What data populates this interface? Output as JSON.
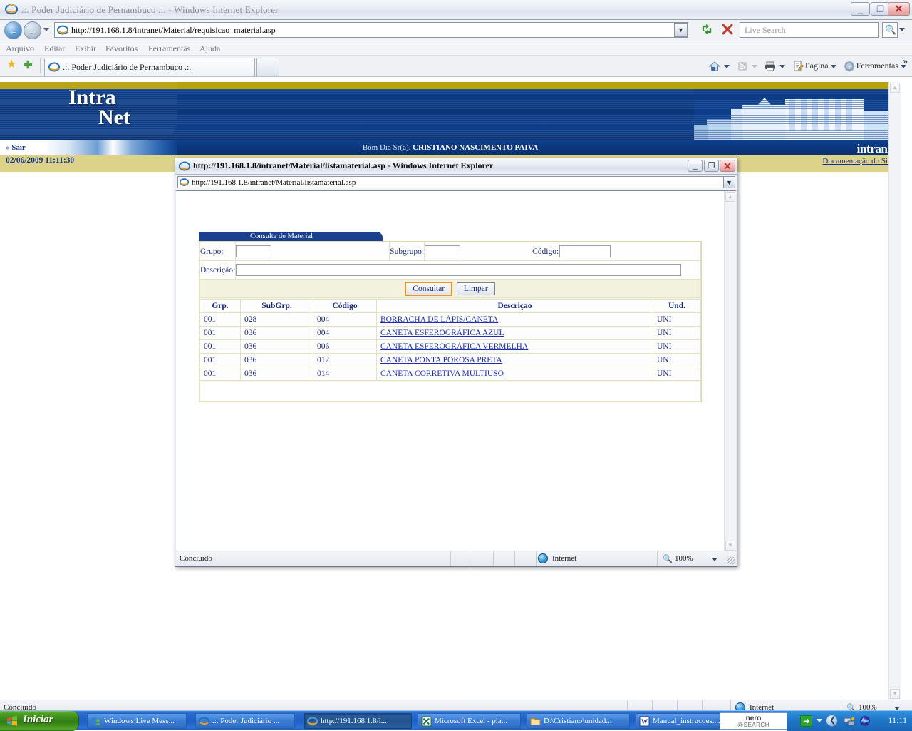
{
  "main_window": {
    "title": ".:. Poder Judiciário de Pernambuco .:. - Windows Internet Explorer",
    "address": "http://191.168.1.8/intranet/Material/requisicao_material.asp",
    "search_placeholder": "Live Search",
    "menu": [
      "Arquivo",
      "Editar",
      "Exibir",
      "Favoritos",
      "Ferramentas",
      "Ajuda"
    ],
    "tab_label": ".:. Poder Judiciário de Pernambuco .:.",
    "command_bar": [
      {
        "label": "",
        "icon": "home-icon"
      },
      {
        "label": "",
        "icon": "rss-icon"
      },
      {
        "label": "",
        "icon": "print-icon"
      },
      {
        "label": "Página",
        "icon": "page-icon"
      },
      {
        "label": "Ferramentas",
        "icon": "gear-icon"
      }
    ],
    "status_text": "Concluído",
    "zone": "Internet",
    "zoom": "100%"
  },
  "intranet": {
    "logo_line1": "Intra",
    "logo_line2": "Net",
    "logout_label": "« Sair",
    "greeting_prefix": "Bom Dia Sr(a).",
    "user_name": "CRISTIANO NASCIMENTO PAIVA",
    "brand_tag": "intranet",
    "datetime": "02/06/2009 11:11:30",
    "doc_link": "Documentação do Site",
    "colors": {
      "banner_blue": "#0b3f8f",
      "gold": "#b8a10c",
      "gold_bar": "#ddd28a",
      "link_blue": "#10348c"
    }
  },
  "popup": {
    "title": "http://191.168.1.8/intranet/Material/listamaterial.asp - Windows Internet Explorer",
    "address": "http://191.168.1.8/intranet/Material/listamaterial.asp",
    "status_text": "Concluído",
    "zone": "Internet",
    "zoom": "100%",
    "form": {
      "card_title": "Consulta de Material",
      "fields": [
        {
          "label": "Grupo:",
          "value": ""
        },
        {
          "label": "Subgrupo:",
          "value": ""
        },
        {
          "label": "Código:",
          "value": ""
        },
        {
          "label": "Descrição:",
          "value": ""
        }
      ],
      "submit_label": "Consultar",
      "clear_label": "Limpar"
    },
    "results": {
      "headers": [
        "Grp.",
        "SubGrp.",
        "Código",
        "Descriçao",
        "Und."
      ],
      "rows": [
        {
          "grp": "001",
          "subgrp": "028",
          "codigo": "004",
          "descricao": "BORRACHA DE LÁPIS/CANETA",
          "und": "UNI"
        },
        {
          "grp": "001",
          "subgrp": "036",
          "codigo": "004",
          "descricao": "CANETA ESFEROGRÁFICA AZUL",
          "und": "UNI"
        },
        {
          "grp": "001",
          "subgrp": "036",
          "codigo": "006",
          "descricao": "CANETA ESFEROGRÁFICA VERMELHA",
          "und": "UNI"
        },
        {
          "grp": "001",
          "subgrp": "036",
          "codigo": "012",
          "descricao": "CANETA PONTA POROSA PRETA",
          "und": "UNI"
        },
        {
          "grp": "001",
          "subgrp": "036",
          "codigo": "014",
          "descricao": "CANETA CORRETIVA MULTIUSO",
          "und": "UNI"
        }
      ]
    }
  },
  "taskbar": {
    "start_label": "Iniciar",
    "buttons": [
      {
        "label": "Windows Live Mess...",
        "icon": "messenger-icon",
        "active": false
      },
      {
        "label": ".:. Poder Judiciário ...",
        "icon": "ie-icon",
        "active": false
      },
      {
        "label": "http://191.168.1.8/i...",
        "icon": "ie-icon",
        "active": true
      },
      {
        "label": "Microsoft Excel - pla...",
        "icon": "excel-icon",
        "active": false
      },
      {
        "label": "D:\\Cristiano\\unidad...",
        "icon": "folder-icon",
        "active": false
      },
      {
        "label": "Manual_instrucoes....",
        "icon": "word-icon",
        "active": false
      }
    ],
    "tray": {
      "nero_line1": "nero",
      "nero_line2": "@SEARCH",
      "clock": "11:11"
    }
  }
}
